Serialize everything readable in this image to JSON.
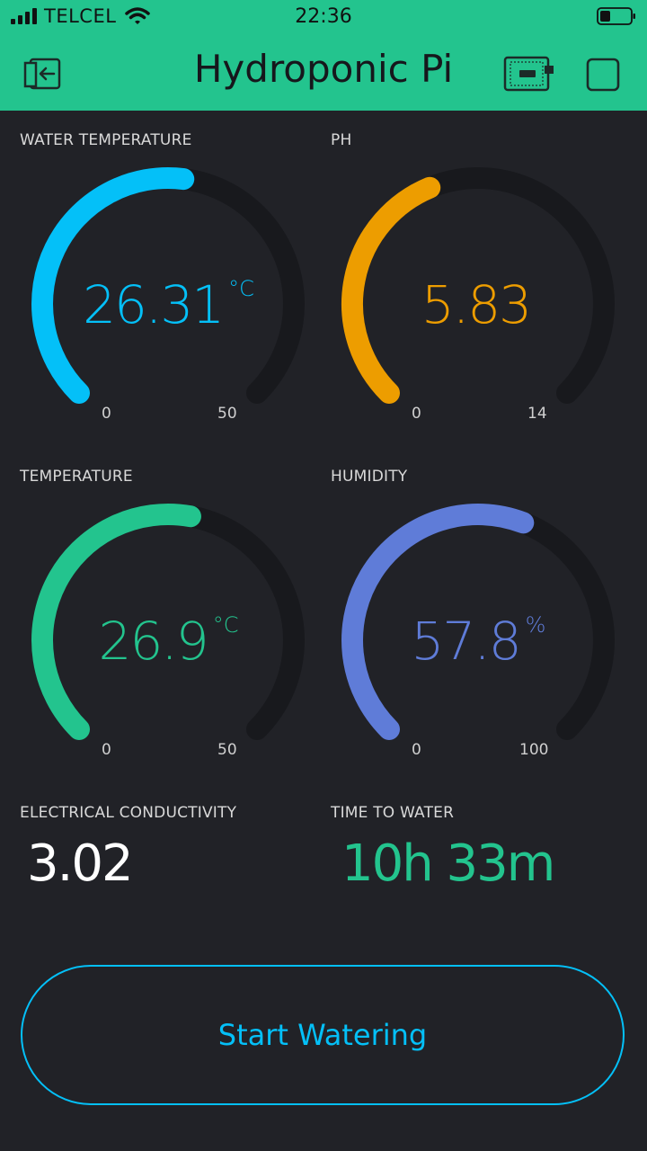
{
  "status_bar": {
    "carrier": "TELCEL",
    "time": "22:36"
  },
  "header": {
    "title": "Hydroponic Pi",
    "icons": [
      "exit-icon",
      "device-icon",
      "square-icon"
    ]
  },
  "gauges": [
    {
      "label": "WATER TEMPERATURE",
      "value": "26.31",
      "unit": "°C",
      "min": "0",
      "max": "50",
      "fraction": 0.5262,
      "color": "#04c0f8"
    },
    {
      "label": "PH",
      "value": "5.83",
      "unit": "",
      "min": "0",
      "max": "14",
      "fraction": 0.4164,
      "color": "#ed9d00"
    },
    {
      "label": "TEMPERATURE",
      "value": "26.9",
      "unit": "°C",
      "min": "0",
      "max": "50",
      "fraction": 0.538,
      "color": "#23c48e"
    },
    {
      "label": "HUMIDITY",
      "value": "57.8",
      "unit": "%",
      "min": "0",
      "max": "100",
      "fraction": 0.578,
      "color": "#5f7cd8"
    }
  ],
  "values": [
    {
      "label": "ELECTRICAL CONDUCTIVITY",
      "value": "3.02",
      "color": "#ffffff"
    },
    {
      "label": "TIME TO WATER",
      "value": "10h 33m",
      "color": "#23c48e"
    }
  ],
  "button": {
    "label": "Start Watering",
    "color": "#04c0f8"
  },
  "colors": {
    "header": "#23c48e",
    "background": "#212227",
    "track": "#18191d"
  }
}
